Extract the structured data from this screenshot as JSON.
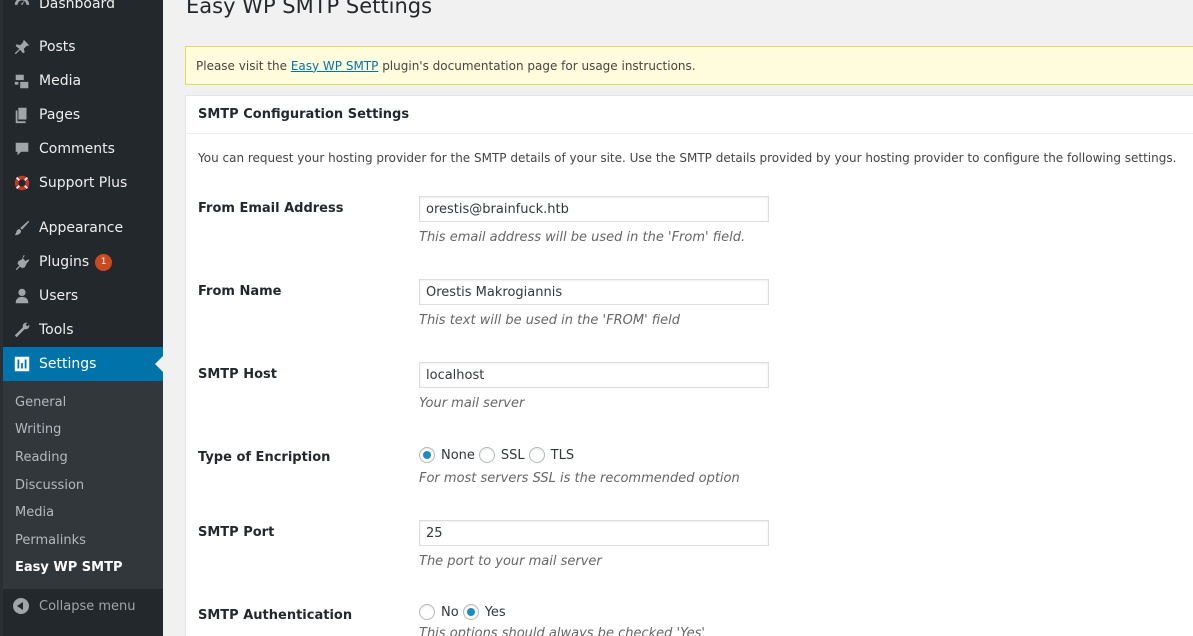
{
  "sidebar": {
    "top_partial": "Dashboard",
    "items": [
      {
        "label": "Posts",
        "icon": "pin-icon"
      },
      {
        "label": "Media",
        "icon": "media-icon"
      },
      {
        "label": "Pages",
        "icon": "pages-icon"
      },
      {
        "label": "Comments",
        "icon": "comment-icon"
      },
      {
        "label": "Support Plus",
        "icon": "lifebuoy-icon"
      },
      {
        "label": "Appearance",
        "icon": "brush-icon"
      },
      {
        "label": "Plugins",
        "icon": "plugin-icon",
        "badge": "1"
      },
      {
        "label": "Users",
        "icon": "user-icon"
      },
      {
        "label": "Tools",
        "icon": "wrench-icon"
      },
      {
        "label": "Settings",
        "icon": "settings-icon",
        "active": true
      }
    ],
    "submenu": [
      "General",
      "Writing",
      "Reading",
      "Discussion",
      "Media",
      "Permalinks",
      "Easy WP SMTP"
    ],
    "collapse_label": "Collapse menu"
  },
  "page": {
    "title": "Easy WP SMTP Settings",
    "notice_prefix": "Please visit the ",
    "notice_link": "Easy WP SMTP",
    "notice_suffix": " plugin's documentation page for usage instructions.",
    "panel_title": "SMTP Configuration Settings",
    "intro": "You can request your hosting provider for the SMTP details of your site. Use the SMTP details provided by your hosting provider to configure the following settings."
  },
  "fields": {
    "from_email": {
      "label": "From Email Address",
      "value": "orestis@brainfuck.htb",
      "desc": "This email address will be used in the 'From' field."
    },
    "from_name": {
      "label": "From Name",
      "value": "Orestis Makrogiannis",
      "desc": "This text will be used in the 'FROM' field"
    },
    "smtp_host": {
      "label": "SMTP Host",
      "value": "localhost",
      "desc": "Your mail server"
    },
    "encryption": {
      "label": "Type of Encription",
      "options": [
        "None",
        "SSL",
        "TLS"
      ],
      "selected": "None",
      "desc": "For most servers SSL is the recommended option"
    },
    "smtp_port": {
      "label": "SMTP Port",
      "value": "25",
      "desc": "The port to your mail server"
    },
    "smtp_auth": {
      "label": "SMTP Authentication",
      "options": [
        "No",
        "Yes"
      ],
      "selected": "Yes",
      "desc": "This options should always be checked 'Yes'"
    }
  },
  "colors": {
    "sidebar_bg": "#23282d",
    "submenu_bg": "#32373c",
    "accent": "#0073aa",
    "notice_bg": "#fefcdc",
    "badge": "#ca4a1f"
  }
}
